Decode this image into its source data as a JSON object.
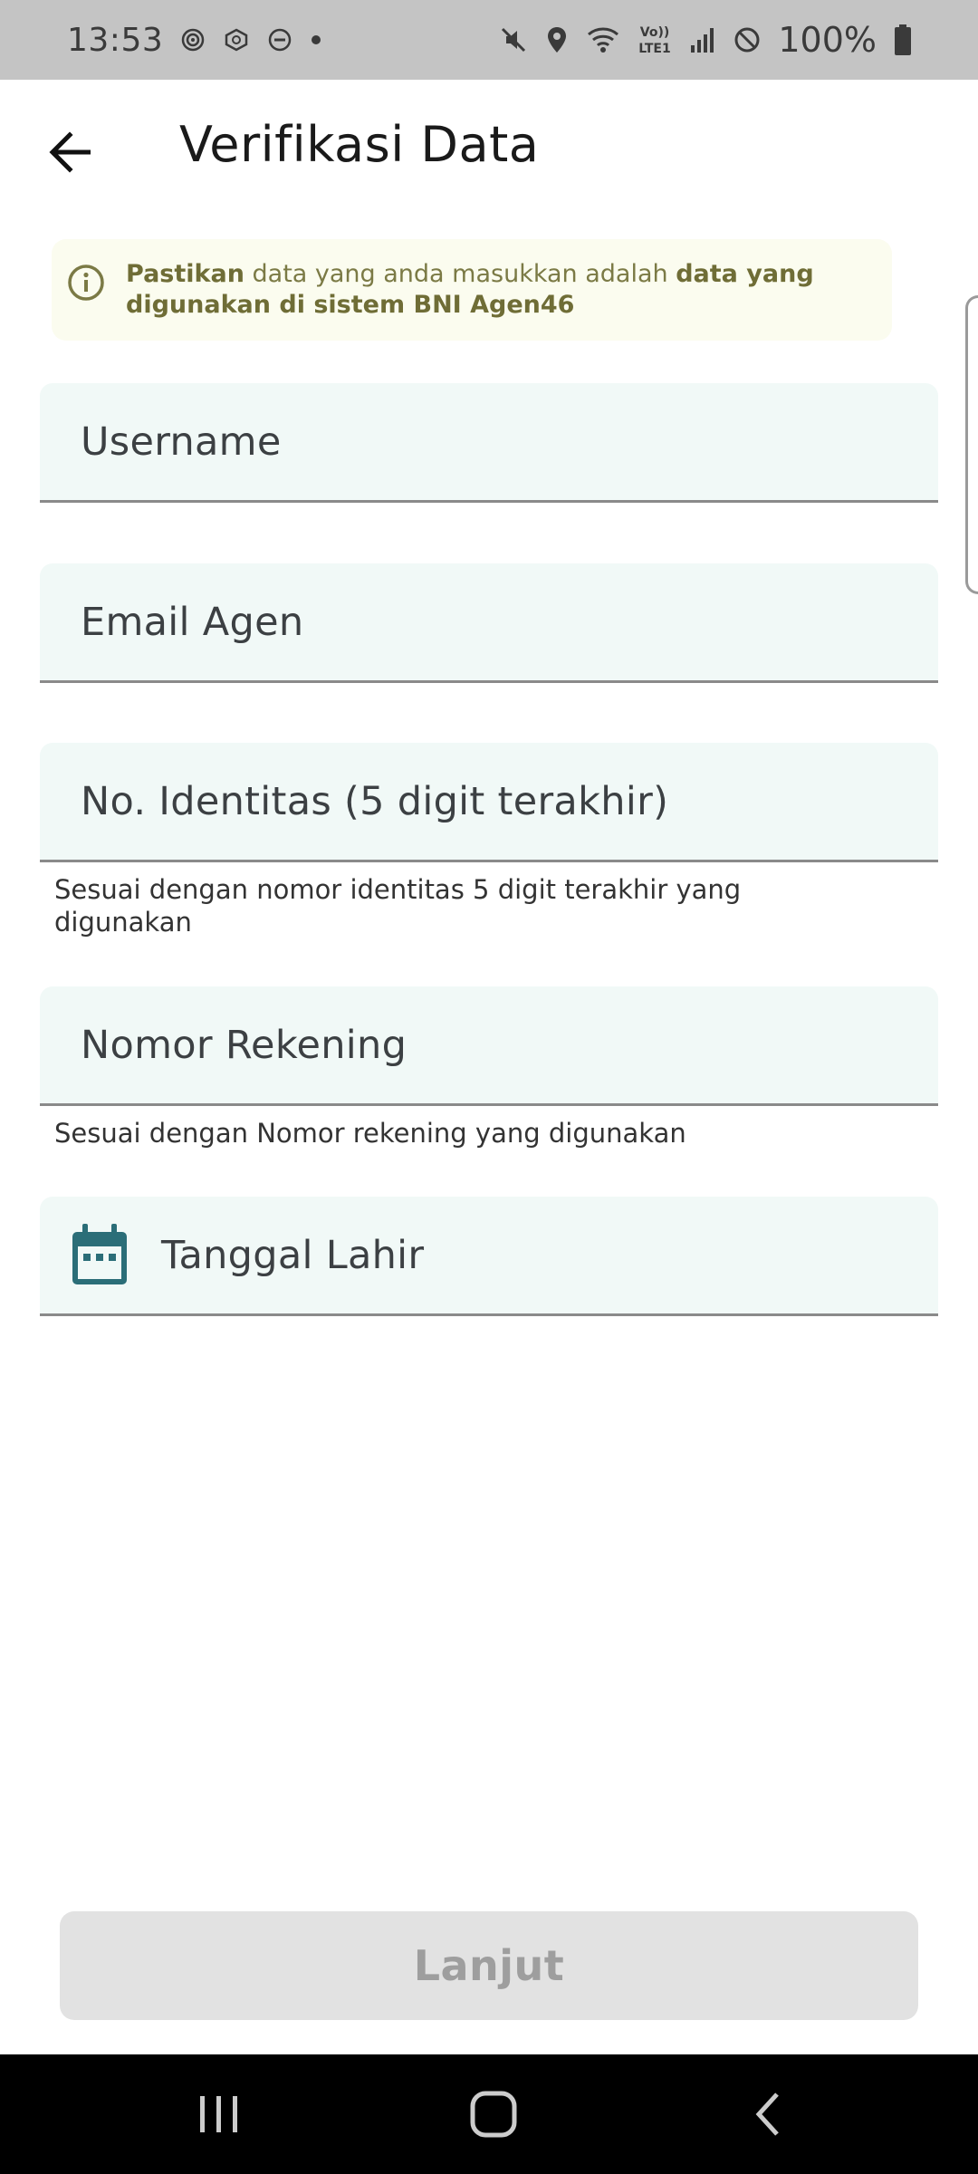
{
  "status_bar": {
    "time": "13:53",
    "battery_text": "100%",
    "icons_left": [
      "vpn-icon",
      "app-notification-icon",
      "do-not-disturb-icon",
      "dot-icon"
    ],
    "icons_right": [
      "mute-icon",
      "location-icon",
      "wifi-icon",
      "volte-icon",
      "signal-icon",
      "blocked-icon",
      "battery-icon"
    ],
    "volte_top": "Vo))",
    "volte_bottom": "LTE1"
  },
  "app_bar": {
    "title": "Verifikasi Data",
    "back_icon": "arrow-left-icon"
  },
  "info_banner": {
    "icon": "info-circle-icon",
    "bold_start": "Pastikan",
    "middle": " data yang anda masukkan adalah ",
    "bold_end": "data yang digunakan di sistem BNI Agen46",
    "color": "#7b7a45"
  },
  "form": {
    "username": {
      "label": "Username"
    },
    "email": {
      "label": "Email Agen"
    },
    "identity": {
      "label": "No. Identitas (5 digit terakhir)",
      "helper": "Sesuai dengan nomor identitas 5 digit terakhir yang digunakan"
    },
    "account": {
      "label": "Nomor Rekening",
      "helper": "Sesuai dengan Nomor rekening yang digunakan"
    },
    "birthdate": {
      "label": "Tanggal Lahir",
      "icon": "calendar-icon"
    }
  },
  "actions": {
    "next_label": "Lanjut"
  },
  "nav_bar": {
    "recents": "recents-icon",
    "home": "home-icon",
    "back": "back-icon"
  },
  "colors": {
    "field_bg": "#f1f9f7",
    "calendar": "#2b6e78",
    "button_bg": "#e2e2e2",
    "button_text": "#9e9e9e"
  }
}
